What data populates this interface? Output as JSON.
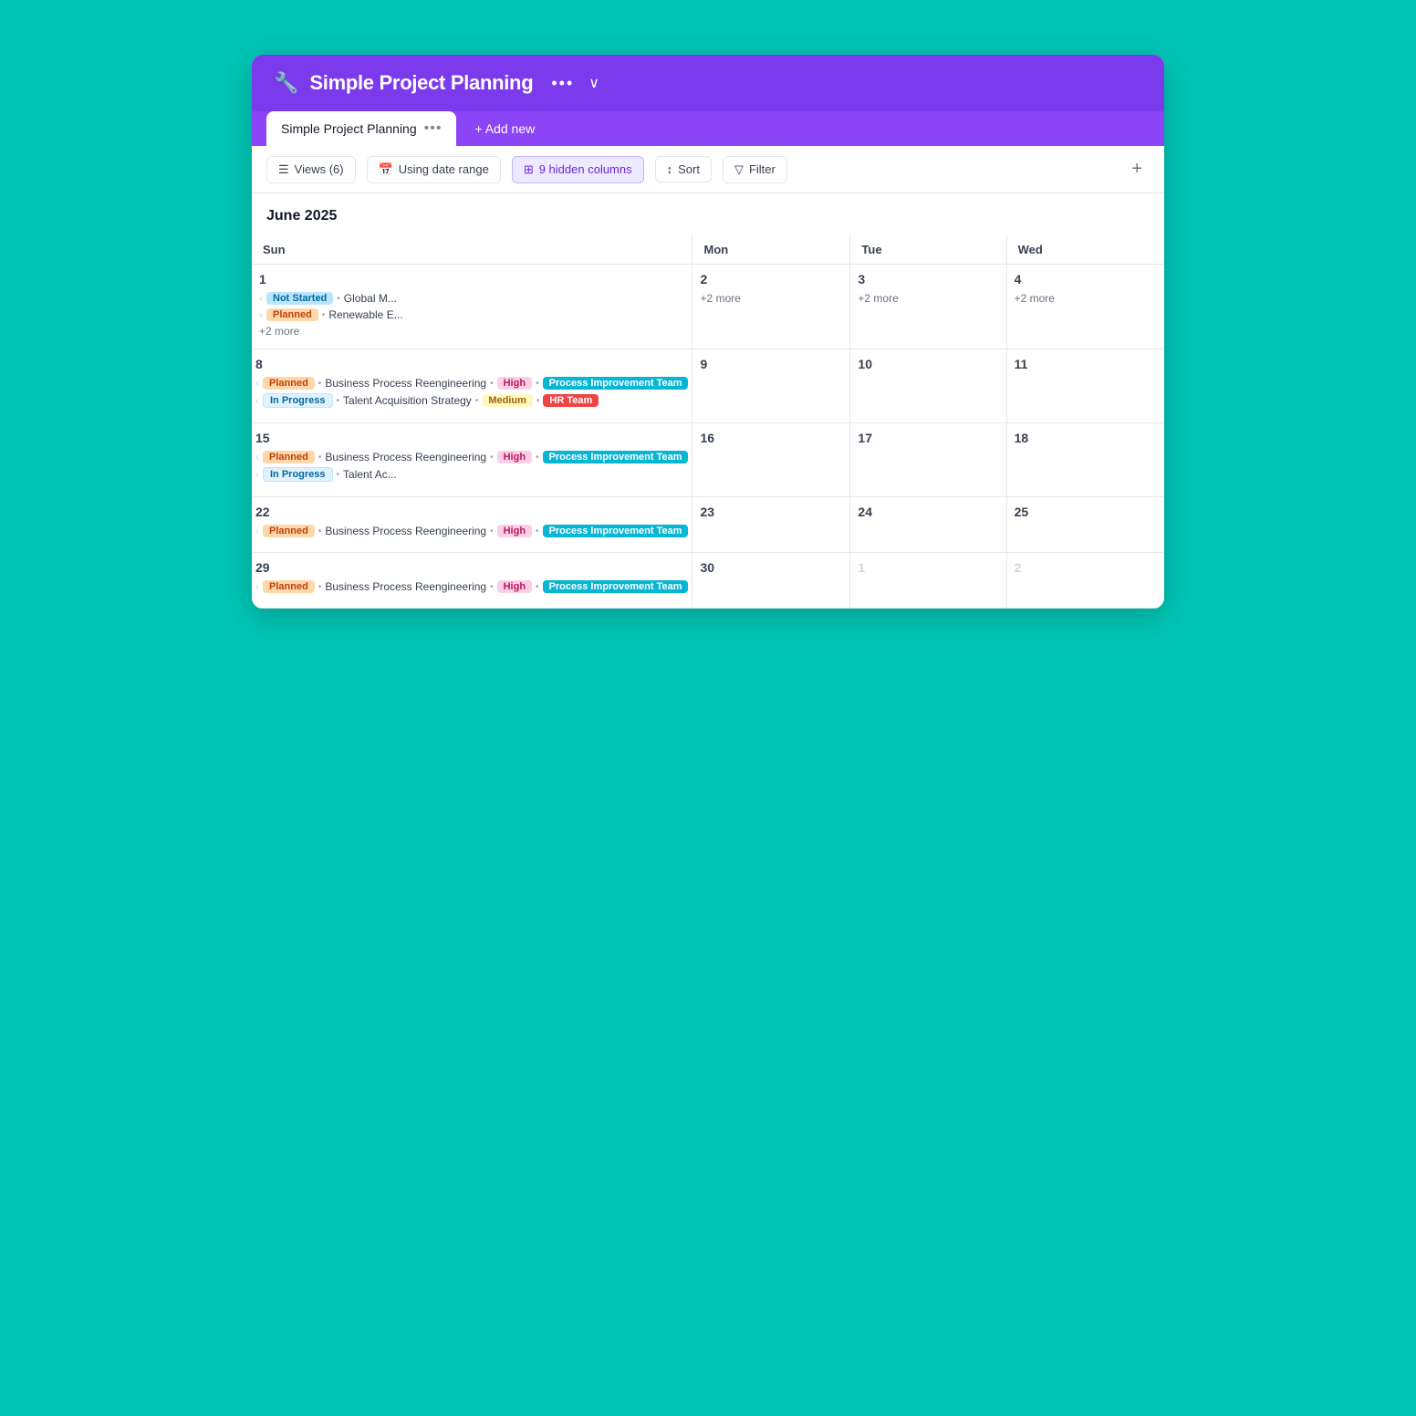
{
  "header": {
    "icon": "🔧",
    "title": "Simple Project Planning",
    "dots": "•••",
    "chevron": "∨"
  },
  "tabs": {
    "active_tab": "Simple Project Planning",
    "tab_dots": "•••",
    "add_new": "+ Add new"
  },
  "toolbar": {
    "views": "Views (6)",
    "date_range": "Using date range",
    "hidden_columns": "9 hidden columns",
    "sort": "Sort",
    "filter": "Filter",
    "plus": "+"
  },
  "calendar": {
    "month": "June 2025",
    "weekdays": [
      "Sun",
      "Mon",
      "Tue",
      "Wed"
    ],
    "weeks": [
      {
        "days": [
          {
            "number": "1",
            "events": [
              {
                "type": "badge-not-started",
                "badge": "Not Started",
                "dot": true,
                "text": "Global M..."
              },
              {
                "type": "badge-planned",
                "badge": "Planned",
                "dot": true,
                "text": "Renewable E..."
              }
            ],
            "more": "+2 more"
          },
          {
            "number": "2",
            "events": [],
            "more": "+2 more"
          },
          {
            "number": "3",
            "events": [],
            "more": "+2 more"
          },
          {
            "number": "4",
            "events": [],
            "more": "+2 more"
          }
        ]
      },
      {
        "days": [
          {
            "number": "8",
            "events": [
              {
                "multispan": true,
                "badge": "Planned",
                "badge_class": "badge-planned",
                "text": "Business Process Reengineering",
                "priority": "High",
                "priority_class": "badge-high",
                "team": "Process Improvement Team",
                "team_class": "badge-team-process"
              },
              {
                "multispan": true,
                "badge": "In Progress",
                "badge_class": "badge-in-progress",
                "text": "Talent Acquisition Strategy",
                "priority": "Medium",
                "priority_class": "badge-medium",
                "team": "HR Team",
                "team_class": "badge-team-hr"
              }
            ],
            "more": ""
          },
          {
            "number": "9",
            "events": [],
            "more": ""
          },
          {
            "number": "10",
            "events": [],
            "more": ""
          },
          {
            "number": "11",
            "events": [],
            "more": ""
          }
        ]
      },
      {
        "days": [
          {
            "number": "15",
            "events": [
              {
                "multispan": true,
                "badge": "Planned",
                "badge_class": "badge-planned",
                "text": "Business Process Reengineering",
                "priority": "High",
                "priority_class": "badge-high",
                "team": "Process Improvement Team",
                "team_class": "badge-team-process"
              },
              {
                "simple": true,
                "badge": "In Progress",
                "badge_class": "badge-in-progress",
                "text": "Talent Ac..."
              }
            ],
            "more": ""
          },
          {
            "number": "16",
            "events": [],
            "more": ""
          },
          {
            "number": "17",
            "events": [],
            "more": ""
          },
          {
            "number": "18",
            "events": [],
            "more": ""
          }
        ]
      },
      {
        "days": [
          {
            "number": "22",
            "events": [
              {
                "multispan": true,
                "badge": "Planned",
                "badge_class": "badge-planned",
                "text": "Business Process Reengineering",
                "priority": "High",
                "priority_class": "badge-high",
                "team": "Process Improvement Team",
                "team_class": "badge-team-process"
              }
            ],
            "more": ""
          },
          {
            "number": "23",
            "events": [],
            "more": ""
          },
          {
            "number": "24",
            "events": [],
            "more": ""
          },
          {
            "number": "25",
            "events": [],
            "more": ""
          }
        ]
      },
      {
        "days": [
          {
            "number": "29",
            "events": [
              {
                "multispan": true,
                "badge": "Planned",
                "badge_class": "badge-planned",
                "text": "Business Process Reengineering",
                "priority": "High",
                "priority_class": "badge-high",
                "team": "Process Improvement Team",
                "team_class": "badge-team-process"
              }
            ],
            "more": ""
          },
          {
            "number": "30",
            "events": [],
            "more": ""
          },
          {
            "number_gray": "1",
            "events": [],
            "more": ""
          },
          {
            "number_gray": "2",
            "events": [],
            "more": ""
          }
        ]
      }
    ]
  }
}
